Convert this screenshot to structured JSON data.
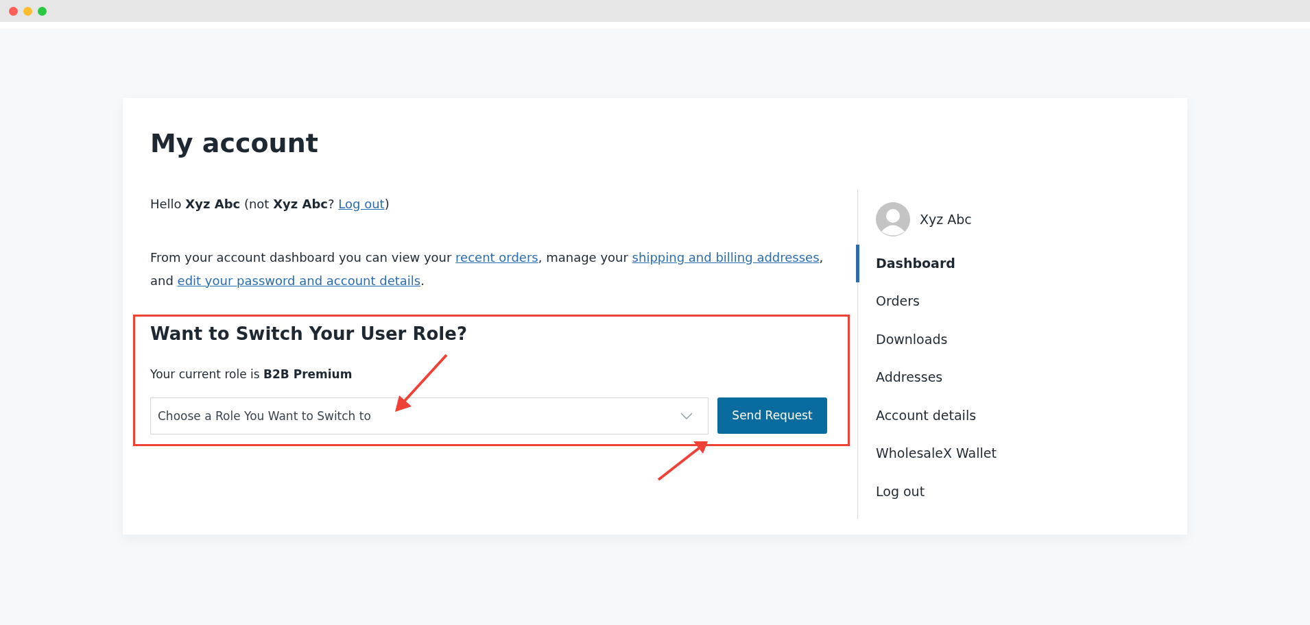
{
  "page_title": "My account",
  "greeting": [
    {
      "text": "Hello **Xyz Abc** (not **Xyz Abc**? ",
      "link": false
    },
    {
      "text": "Log out",
      "link": true
    },
    {
      "text": ")",
      "link": false
    }
  ],
  "intro": [
    {
      "text": "From your account dashboard you can view your ",
      "link": false
    },
    {
      "text": "recent orders",
      "link": true
    },
    {
      "text": ", manage your ",
      "link": false
    },
    {
      "text": "shipping and billing addresses",
      "link": true
    },
    {
      "text": ", and ",
      "link": false
    },
    {
      "text": "edit your password and account details",
      "link": true
    },
    {
      "text": ".",
      "link": false
    }
  ],
  "role_switch": {
    "heading": "Want to Switch Your User Role?",
    "current_role": "Your current role is **B2B Premium**",
    "select": {
      "placeholder": "Choose a Role You Want to Switch to"
    },
    "button": "Send Request"
  },
  "sidebar": {
    "user": "Xyz Abc",
    "items": [
      {
        "label": "Dashboard",
        "selected": true
      },
      {
        "label": "Orders",
        "selected": false
      },
      {
        "label": "Downloads",
        "selected": false
      },
      {
        "label": "Addresses",
        "selected": false
      },
      {
        "label": "Account details",
        "selected": false
      },
      {
        "label": "WholesaleX Wallet",
        "selected": false
      },
      {
        "label": "Log out",
        "selected": false
      }
    ]
  }
}
